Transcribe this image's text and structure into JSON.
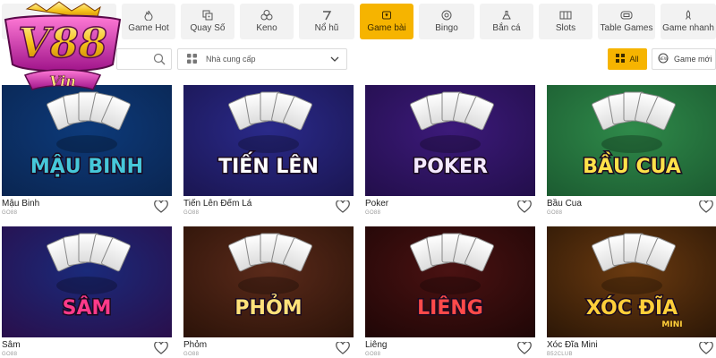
{
  "logo": {
    "brand": "V88",
    "sub": "Vin"
  },
  "categories": [
    {
      "label": "",
      "icon": "gamepad-icon"
    },
    {
      "label": "",
      "icon": "gamepad-icon"
    },
    {
      "label": "Game Hot",
      "icon": "flame-icon"
    },
    {
      "label": "Quay Số",
      "icon": "dice-icon"
    },
    {
      "label": "Keno",
      "icon": "balls-icon"
    },
    {
      "label": "Nổ hũ",
      "icon": "seven-icon"
    },
    {
      "label": "Game bài",
      "icon": "cards-icon",
      "active": true
    },
    {
      "label": "Bingo",
      "icon": "bingo-icon"
    },
    {
      "label": "Bắn cá",
      "icon": "fish-shooter-icon"
    },
    {
      "label": "Slots",
      "icon": "slot-machine-icon"
    },
    {
      "label": "Table Games",
      "icon": "table-icon"
    },
    {
      "label": "Game nhanh",
      "icon": "rocket-icon"
    }
  ],
  "filters": {
    "search_placeholder": "",
    "provider_placeholder": "Nhà cung cấp",
    "all_label": "All",
    "new_label": "Game mới"
  },
  "games": [
    {
      "name": "Mậu Binh",
      "provider": "GO88",
      "art_title": "MẬU BINH",
      "bg": "#0d3a7a",
      "bg2": "#0a2550",
      "text_color": "#46c7d9"
    },
    {
      "name": "Tiến Lên Đếm Lá",
      "provider": "GO88",
      "art_title": "TIẾN LÊN",
      "bg": "#2a2a8a",
      "bg2": "#1a1550",
      "text_color": "#ffffff"
    },
    {
      "name": "Poker",
      "provider": "GO88",
      "art_title": "POKER",
      "bg": "#3c1a7a",
      "bg2": "#220e4a",
      "text_color": "#f4e9ff"
    },
    {
      "name": "Bầu Cua",
      "provider": "GO88",
      "art_title": "BẦU CUA",
      "bg": "#2f8a4a",
      "bg2": "#1b5a30",
      "text_color": "#ffe14a"
    },
    {
      "name": "Sâm",
      "provider": "GO88",
      "art_title": "SÂM",
      "bg": "#1a2a7a",
      "bg2": "#2a0e4a",
      "text_color": "#ff3a8a"
    },
    {
      "name": "Phỏm",
      "provider": "GO88",
      "art_title": "PHỎM",
      "bg": "#5a2a1a",
      "bg2": "#2a1208",
      "text_color": "#ffe27a"
    },
    {
      "name": "Liêng",
      "provider": "GO88",
      "art_title": "LIÊNG",
      "bg": "#4a1212",
      "bg2": "#1e0606",
      "text_color": "#ff4a4a"
    },
    {
      "name": "Xóc Đĩa Mini",
      "provider": "B52CLUB",
      "art_title": "XÓC ĐĨA",
      "art_sub": "MINI",
      "bg": "#6a3a10",
      "bg2": "#2a1606",
      "text_color": "#ffcf3a"
    }
  ],
  "colors": {
    "accent": "#f6b400",
    "chip": "#f2f2f2"
  }
}
